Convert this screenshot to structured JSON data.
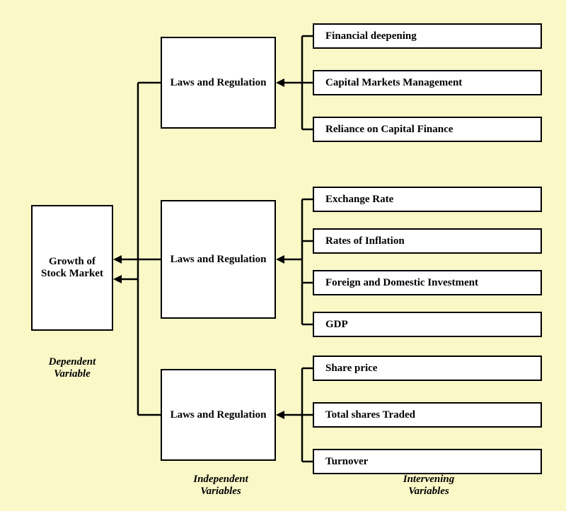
{
  "dependent": {
    "label": "Growth of\nStock Market",
    "caption": "Dependent\nVariable"
  },
  "independent": {
    "group1": "Laws and Regulation",
    "group2": "Laws and Regulation",
    "group3": "Laws and Regulation",
    "caption": "Independent\nVariables"
  },
  "intervening": {
    "group1": [
      "Financial deepening",
      "Capital Markets Management",
      "Reliance on Capital Finance"
    ],
    "group2": [
      "Exchange Rate",
      "Rates of Inflation",
      "Foreign and Domestic Investment",
      "GDP"
    ],
    "group3": [
      "Share price",
      "Total shares Traded",
      "Turnover"
    ],
    "caption": "Intervening\nVariables"
  }
}
